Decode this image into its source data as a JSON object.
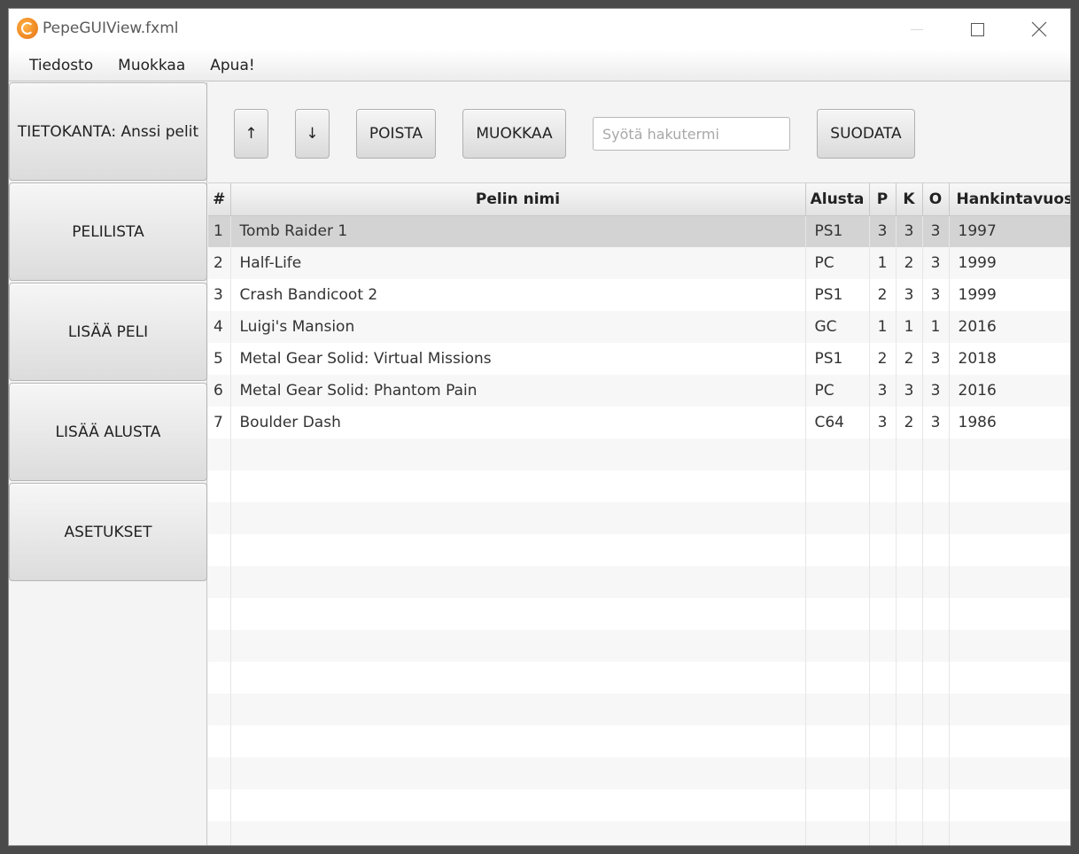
{
  "window": {
    "title": "PepeGUIView.fxml"
  },
  "menu": [
    "Tiedosto",
    "Muokkaa",
    "Apua!"
  ],
  "sidebar": {
    "database_label": "TIETOKANTA: Anssi pelit",
    "items": [
      "PELILISTA",
      "LISÄÄ PELI",
      "LISÄÄ ALUSTA",
      "ASETUKSET"
    ]
  },
  "toolbar": {
    "up_label": "↑",
    "down_label": "↓",
    "delete_label": "POISTA",
    "edit_label": "MUOKKAA",
    "search_placeholder": "Syötä hakutermi",
    "search_value": "",
    "filter_label": "SUODATA"
  },
  "table": {
    "columns": [
      "#",
      "Pelin nimi",
      "Alusta",
      "P",
      "K",
      "O",
      "Hankintavuosi"
    ],
    "selected_row": 0,
    "rows": [
      [
        "1",
        "Tomb Raider 1",
        "PS1",
        "3",
        "3",
        "3",
        "1997"
      ],
      [
        "2",
        "Half-Life",
        "PC",
        "1",
        "2",
        "3",
        "1999"
      ],
      [
        "3",
        "Crash Bandicoot 2",
        "PS1",
        "2",
        "3",
        "3",
        "1999"
      ],
      [
        "4",
        "Luigi's Mansion",
        "GC",
        "1",
        "1",
        "1",
        "2016"
      ],
      [
        "5",
        "Metal Gear Solid: Virtual Missions",
        "PS1",
        "2",
        "2",
        "3",
        "2018"
      ],
      [
        "6",
        "Metal Gear Solid: Phantom Pain",
        "PC",
        "3",
        "3",
        "3",
        "2016"
      ],
      [
        "7",
        "Boulder Dash",
        "C64",
        "3",
        "2",
        "3",
        "1986"
      ]
    ]
  },
  "colors": {
    "selection": "#d3d3d3",
    "app_icon": "#f08a24"
  }
}
